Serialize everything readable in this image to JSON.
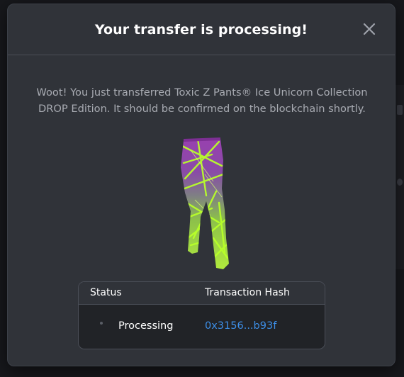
{
  "modal": {
    "title": "Your transfer is processing!",
    "close_icon": "close-icon",
    "message": "Woot! You just transferred Toxic Z Pants® Ice Unicorn Collection DROP Edition. It should be confirmed on the blockchain shortly.",
    "item_image": "leggings-purple-to-neon-green-gradient"
  },
  "table": {
    "headers": [
      "Status",
      "Transaction Hash"
    ],
    "rows": [
      {
        "status": "Processing",
        "hash": "0x3156...b93f"
      }
    ]
  },
  "colors": {
    "modal_bg": "#303339",
    "table_bg": "#212327",
    "link": "#3d8fe8",
    "text_muted": "#a8abb2",
    "pants_purple": "#9b3fb0",
    "pants_green": "#a8f03a"
  }
}
